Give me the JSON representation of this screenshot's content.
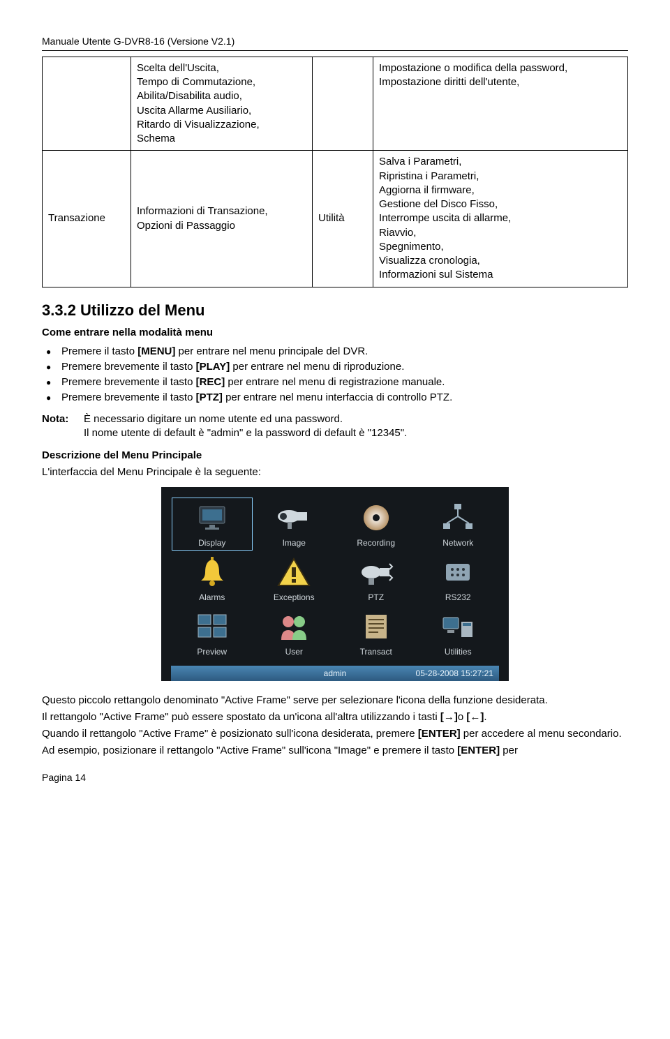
{
  "header": "Manuale Utente G-DVR8-16 (Versione V2.1)",
  "table": {
    "r1c1": "",
    "r1c2": "Scelta dell'Uscita,\nTempo di Commutazione,\nAbilita/Disabilita audio,\nUscita Allarme Ausiliario,\nRitardo di Visualizzazione,\nSchema",
    "r1c3": "",
    "r1c4": "Impostazione o modifica della password,\nImpostazione diritti dell'utente,",
    "r2c1": "Transazione",
    "r2c2": "Informazioni di Transazione,\nOpzioni di Passaggio",
    "r2c3": "Utilità",
    "r2c4": "Salva i Parametri,\nRipristina i Parametri,\nAggiorna il firmware,\nGestione del Disco Fisso,\nInterrompe uscita di allarme,\nRiavvio,\nSpegnimento,\nVisualizza cronologia,\nInformazioni sul Sistema"
  },
  "section_heading": "3.3.2 Utilizzo del Menu",
  "subheading1": "Come entrare nella modalità menu",
  "bullets": [
    {
      "pre": "Premere il tasto ",
      "key": "[MENU]",
      "post": " per entrare nel menu principale del DVR."
    },
    {
      "pre": "Premere brevemente il tasto ",
      "key": "[PLAY]",
      "post": " per entrare nel menu di riproduzione."
    },
    {
      "pre": "Premere brevemente il tasto ",
      "key": "[REC]",
      "post": " per entrare nel menu di registrazione manuale."
    },
    {
      "pre": "Premere brevemente il tasto ",
      "key": "[PTZ]",
      "post": " per entrare nel menu interfaccia di controllo PTZ."
    }
  ],
  "nota_label": "Nota:",
  "nota_line1": "È necessario digitare un nome utente ed una password.",
  "nota_line2": "Il nome utente di default è \"admin\" e la password di default è \"12345\".",
  "subheading2": "Descrizione del Menu Principale",
  "intro2": "L'interfaccia del Menu Principale è la seguente:",
  "menu_items": [
    {
      "label": "Display",
      "icon": "monitor"
    },
    {
      "label": "Image",
      "icon": "camera"
    },
    {
      "label": "Recording",
      "icon": "disc"
    },
    {
      "label": "Network",
      "icon": "network"
    },
    {
      "label": "Alarms",
      "icon": "bell"
    },
    {
      "label": "Exceptions",
      "icon": "warning"
    },
    {
      "label": "PTZ",
      "icon": "ptz"
    },
    {
      "label": "RS232",
      "icon": "port"
    },
    {
      "label": "Preview",
      "icon": "preview"
    },
    {
      "label": "User",
      "icon": "user"
    },
    {
      "label": "Transact",
      "icon": "transact"
    },
    {
      "label": "Utilities",
      "icon": "utilities"
    }
  ],
  "status_bar": {
    "user": "admin",
    "datetime": "05-28-2008 15:27:21"
  },
  "para1": "Questo piccolo rettangolo denominato \"Active Frame\" serve per selezionare l'icona della funzione desiderata.",
  "para2_pre": "Il rettangolo \"Active Frame\" può essere spostato da un'icona all'altra utilizzando i tasti ",
  "para2_k1": "[→]",
  "para2_mid": "o ",
  "para2_k2": "[←]",
  "para2_post": ".",
  "para3_pre": "Quando il rettangolo \"Active Frame\" è posizionato sull'icona desiderata, premere ",
  "para3_k": "[ENTER]",
  "para3_post": " per accedere al menu secondario.",
  "para4_pre": "Ad esempio, posizionare il rettangolo \"Active Frame\" sull'icona \"Image\" e premere il tasto ",
  "para4_k": "[ENTER]",
  "para4_post": " per",
  "page_num": "Pagina 14"
}
